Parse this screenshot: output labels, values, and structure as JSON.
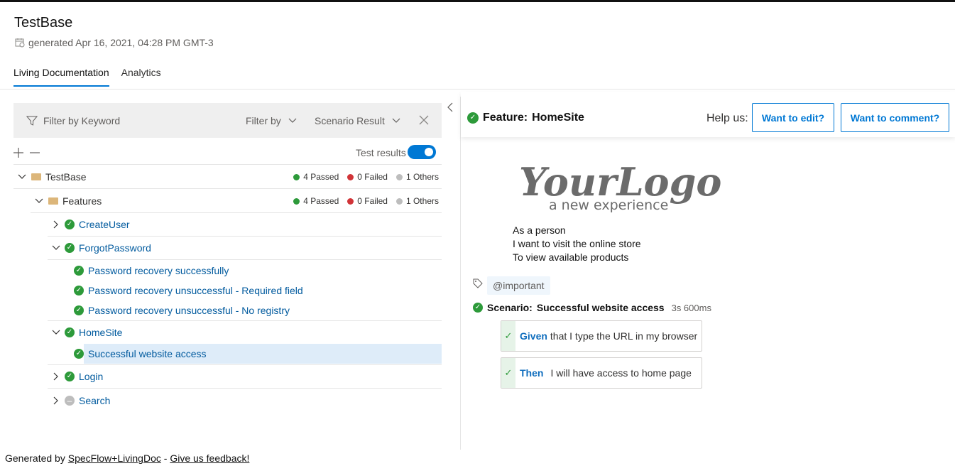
{
  "app": {
    "title": "TestBase",
    "generated": "generated Apr 16, 2021, 04:28 PM GMT-3"
  },
  "tabs": [
    {
      "label": "Living Documentation",
      "active": true
    },
    {
      "label": "Analytics",
      "active": false
    }
  ],
  "filter": {
    "placeholder": "Filter by Keyword",
    "filter_by": "Filter by",
    "scenario_result": "Scenario Result"
  },
  "tree_tools": {
    "test_results": "Test results",
    "toggle_on": true
  },
  "tree": {
    "root": {
      "label": "TestBase",
      "passed": "4 Passed",
      "failed": "0 Failed",
      "others": "1 Others"
    },
    "features": {
      "label": "Features",
      "passed": "4 Passed",
      "failed": "0 Failed",
      "others": "1 Others"
    },
    "items": [
      {
        "label": "CreateUser"
      },
      {
        "label": "ForgotPassword"
      },
      {
        "label": "Password recovery successfully"
      },
      {
        "label": "Password recovery unsuccessful - Required field"
      },
      {
        "label": "Password recovery unsuccessful - No registry"
      },
      {
        "label": "HomeSite"
      },
      {
        "label": "Successful website access"
      },
      {
        "label": "Login"
      },
      {
        "label": "Search"
      }
    ]
  },
  "feature": {
    "prefix": "Feature:",
    "name": "HomeSite",
    "help_us": "Help us:",
    "edit_button": "Want to edit?",
    "comment_button": "Want to comment?",
    "logo_main": "YourLogo",
    "logo_sub": "a new experience",
    "description": [
      "As a person",
      "I want to visit the online store",
      "To view available products"
    ],
    "tag": "@important",
    "scenario_prefix": "Scenario:",
    "scenario_name": "Successful website access",
    "duration": "3s 600ms",
    "steps": [
      {
        "keyword": "Given",
        "text": "that I type the URL in my browser"
      },
      {
        "keyword": "Then",
        "text": "I will have access to home page"
      }
    ]
  },
  "colors": {
    "accent": "#0078d4",
    "passed": "#2d9a3a",
    "failed": "#d13438",
    "others": "#bdbdbd"
  },
  "footer": {
    "prefix": "Generated by",
    "link1": "SpecFlow+LivingDoc",
    "separator": "-",
    "link2": "Give us feedback!"
  }
}
